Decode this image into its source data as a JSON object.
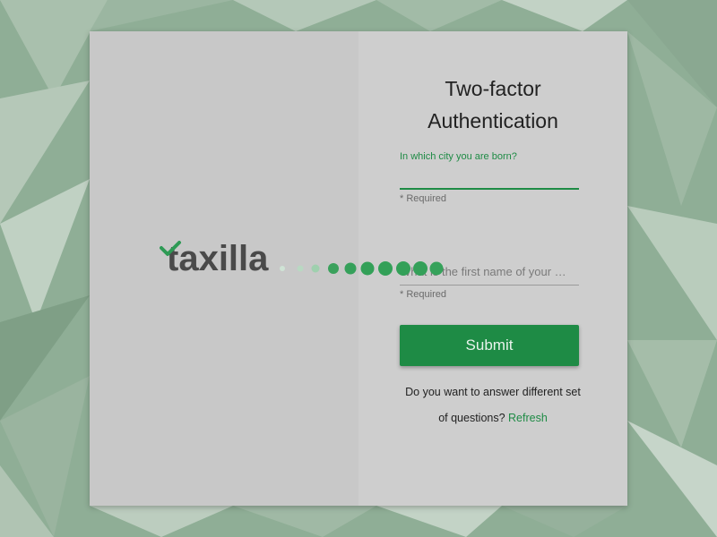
{
  "colors": {
    "accent": "#1e8b45",
    "background": "#8fae96",
    "card": "#cdcdcd"
  },
  "logo": {
    "text": "taxilla",
    "check_icon": "checkmark-icon"
  },
  "loader": {
    "icon": "loading-dots-icon"
  },
  "form": {
    "title_line1": "Two-factor",
    "title_line2": "Authentication",
    "question1": {
      "label": "In which city you are born?",
      "value": "",
      "hint": "* Required"
    },
    "question2": {
      "placeholder": "What is the first name of your …",
      "value": "",
      "hint": "* Required"
    },
    "submit_label": "Submit",
    "footer_text_line1": "Do you want to answer different set",
    "footer_text_line2": "of questions?",
    "refresh_label": "Refresh"
  }
}
